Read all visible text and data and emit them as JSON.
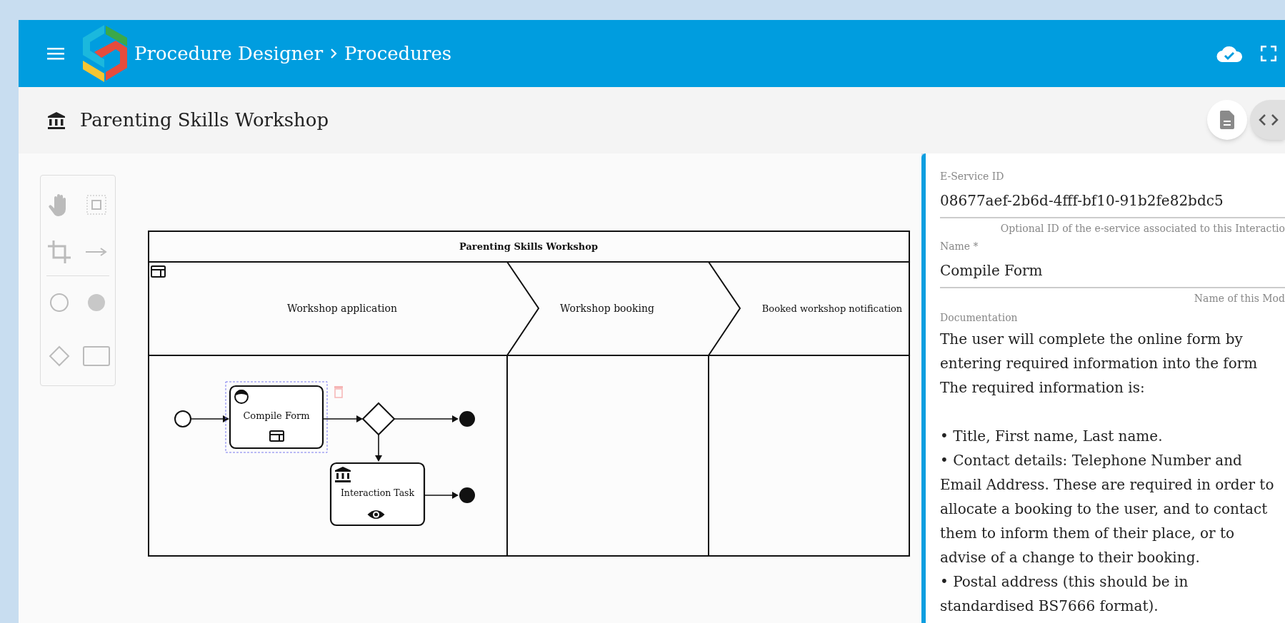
{
  "header": {
    "breadcrumb": [
      "Procedure Designer",
      "Procedures"
    ]
  },
  "procedure": {
    "title": "Parenting Skills Workshop"
  },
  "diagram": {
    "pool_title": "Parenting Skills Workshop",
    "phases": [
      {
        "label": "Workshop application"
      },
      {
        "label": "Workshop booking"
      },
      {
        "label": "Booked workshop notification"
      }
    ],
    "tasks": [
      {
        "kind": "user",
        "label": "Compile Form",
        "selected": true
      },
      {
        "kind": "interaction",
        "label": "Interaction Task",
        "selected": false
      }
    ]
  },
  "properties": {
    "fields": [
      {
        "label": "E-Service ID",
        "value": "08677aef-2b6d-4fff-bf10-91b2fe82bdc5",
        "hint": "Optional ID of the e-service associated to this Interactio"
      },
      {
        "label": "Name *",
        "value": "Compile Form",
        "hint": "Name of this Mod"
      }
    ],
    "documentation_label": "Documentation",
    "documentation": [
      "The user will complete the online form by entering required information into the form",
      "The required information is:",
      "• Title, First name, Last name.",
      "• Contact details: Telephone Number and Email Address. These are required in order to allocate a booking to the user, and to contact them to inform them of their place, or to advise of a change to their booking.",
      "• Postal address (this should be in standardised BS7666 format)."
    ]
  }
}
